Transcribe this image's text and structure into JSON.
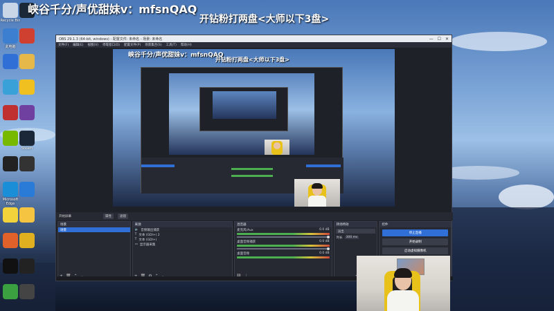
{
  "overlay": {
    "title": "峡谷千分/声优甜妹v：mfsnQAQ",
    "subtitle": "开钻粉打两盘<大师以下3盘>"
  },
  "desktop": {
    "icons": [
      {
        "name": "recycle-bin-icon",
        "label": "Recycle Bin",
        "color": "#c9d6e8"
      },
      {
        "name": "steam-icon",
        "label": "",
        "color": "#1b2838"
      },
      {
        "name": "computer-icon",
        "label": "此电脑",
        "color": "#3c7fd0"
      },
      {
        "name": "app-icon",
        "label": "",
        "color": "#d04030"
      },
      {
        "name": "network-icon",
        "label": "",
        "color": "#2f6fd6"
      },
      {
        "name": "folder-icon",
        "label": "",
        "color": "#e6b84a"
      },
      {
        "name": "control-panel-icon",
        "label": "",
        "color": "#3aa0d8"
      },
      {
        "name": "yellow-app-icon",
        "label": "",
        "color": "#f0c020"
      },
      {
        "name": "red-app-icon",
        "label": "",
        "color": "#c03030"
      },
      {
        "name": "game-icon",
        "label": "",
        "color": "#7040a0"
      },
      {
        "name": "nvidia-icon",
        "label": "",
        "color": "#76b900"
      },
      {
        "name": "steam2-icon",
        "label": "Steam",
        "color": "#1b2838"
      },
      {
        "name": "g-hub-icon",
        "label": "",
        "color": "#222"
      },
      {
        "name": "headset-icon",
        "label": "",
        "color": "#333"
      },
      {
        "name": "edge-icon",
        "label": "Microsoft Edge",
        "color": "#1a8fd8"
      },
      {
        "name": "wegame-icon",
        "label": "",
        "color": "#2a7ad8"
      },
      {
        "name": "yellow-face-icon",
        "label": "",
        "color": "#f2d33c"
      },
      {
        "name": "duck-icon",
        "label": "",
        "color": "#f5c542"
      },
      {
        "name": "orange-icon",
        "label": "",
        "color": "#e0622a"
      },
      {
        "name": "ring-icon",
        "label": "",
        "color": "#e0b020"
      },
      {
        "name": "qq-icon",
        "label": "",
        "color": "#111"
      },
      {
        "name": "black-icon",
        "label": "",
        "color": "#222"
      },
      {
        "name": "green-icon",
        "label": "",
        "color": "#3aa040"
      },
      {
        "name": "clock-icon",
        "label": "",
        "color": "#444"
      }
    ]
  },
  "obs": {
    "window_title": "OBS 29.1.3 (64-bit, windows) - 配置文件: 未命名 - 场景: 未命名",
    "menu": [
      "文件(F)",
      "编辑(E)",
      "视图(V)",
      "停靠窗口(D)",
      "配置文件(P)",
      "场景集合(S)",
      "工具(T)",
      "帮助(H)"
    ],
    "strip": {
      "label": "开始屏幕",
      "btn1": "属性",
      "btn2": "滤镜"
    },
    "panels": {
      "scenes": {
        "title": "场景",
        "items": [
          "场景"
        ]
      },
      "sources": {
        "title": "来源",
        "items": [
          "音频输出捕获",
          "文本 (GDI+) 2",
          "文本 (GDI+)",
          "显示器采集"
        ]
      },
      "mixer": {
        "title": "混音器",
        "channels": [
          {
            "name": "麦克风/Aux",
            "db": "0.0 dB"
          },
          {
            "name": "桌面音频捕获",
            "db": "0.0 dB"
          },
          {
            "name": "桌面音频",
            "db": "0.0 dB"
          }
        ]
      },
      "transitions": {
        "title": "转场特效",
        "type": "淡出",
        "duration_label": "时长",
        "duration": "300 ms"
      },
      "controls": {
        "title": "控件",
        "buttons": [
          "停止直播",
          "开始录制",
          "启动虚拟摄像机",
          "工作室模式",
          "设置",
          "退出"
        ]
      }
    },
    "status": "LIVE: 00:00:00  REC: 00:00:00  CPU: 0.9%"
  },
  "colors": {
    "obs_bg": "#1f2128",
    "accent": "#2f6fd6",
    "panel": "#262932"
  }
}
